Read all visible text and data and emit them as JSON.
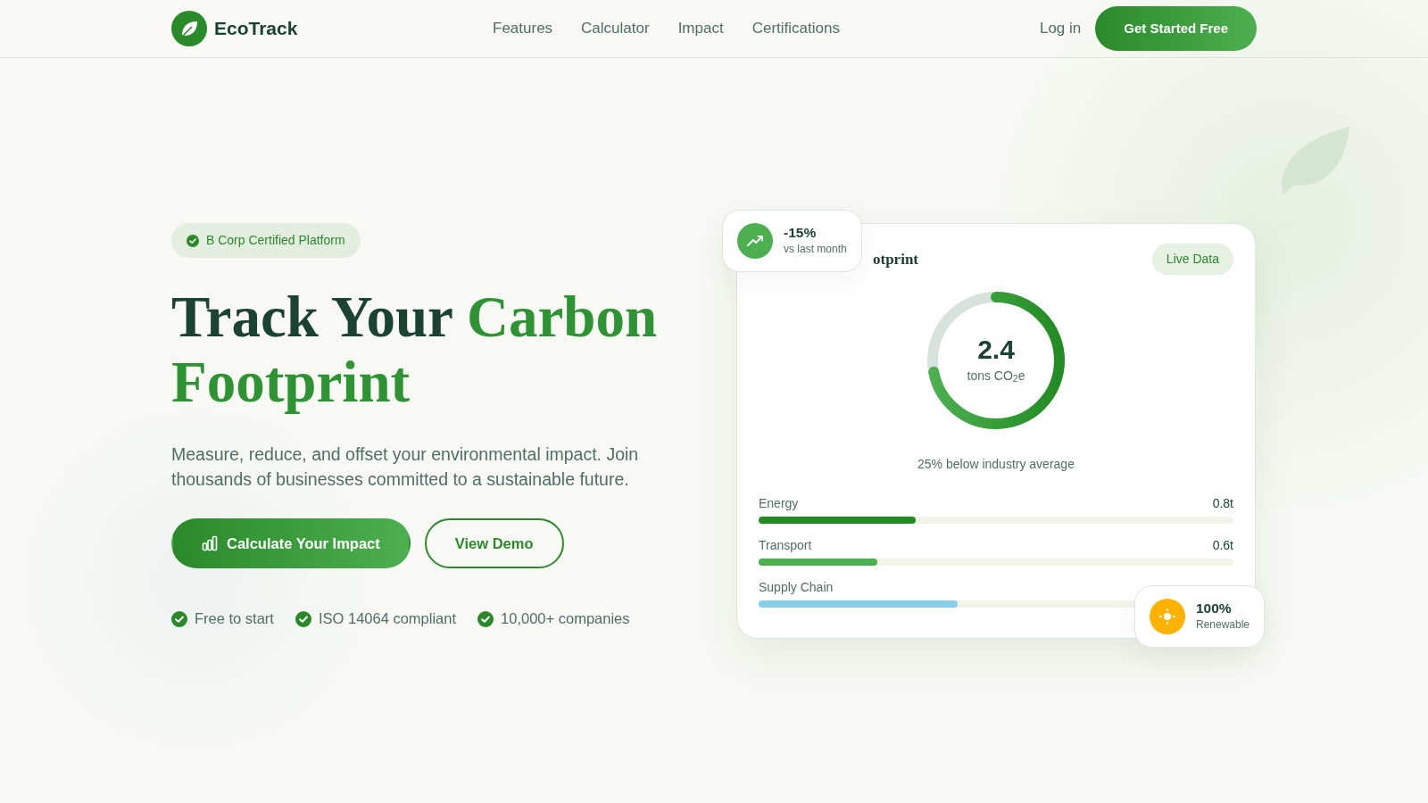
{
  "nav": {
    "brand": "EcoTrack",
    "links": [
      "Features",
      "Calculator",
      "Impact",
      "Certifications"
    ],
    "login": "Log in",
    "cta": "Get Started Free"
  },
  "hero": {
    "badge": "B Corp Certified Platform",
    "heading": [
      {
        "text": "Track Your",
        "accent": false
      },
      {
        "text": "Carbon",
        "accent": true
      },
      {
        "text": "Footprint",
        "accent": true
      }
    ],
    "description": "Measure, reduce, and offset your environmental impact. Join thousands of businesses committed to a sustainable future.",
    "buttons": [
      {
        "label": "Calculate Your Impact",
        "kind": "primary"
      },
      {
        "label": "View Demo",
        "kind": "outline"
      }
    ],
    "features": [
      "Free to start",
      "ISO 14064 compliant",
      "10,000+ companies"
    ]
  },
  "card": {
    "title": "otprint",
    "tag": "Live Data",
    "gauge": {
      "value": "2.4",
      "unit": "tons CO$_{2}$e",
      "level": 0.72
    },
    "note": "25% below industry average",
    "bars": [
      {
        "label": "Energy",
        "value": "0.8t",
        "level": 0.33,
        "color": "#228b22"
      },
      {
        "label": "Transport",
        "value": "0.6t",
        "level": 0.25,
        "color": "#4caf50"
      },
      {
        "label": "Supply Chain",
        "level": 0.42,
        "color": "#87ceeb"
      }
    ]
  },
  "floating": [
    {
      "kind": "trend",
      "value": "-15%",
      "caption": "vs last month"
    },
    {
      "kind": "sun",
      "value": "100%",
      "caption": "Renewable"
    }
  ]
}
